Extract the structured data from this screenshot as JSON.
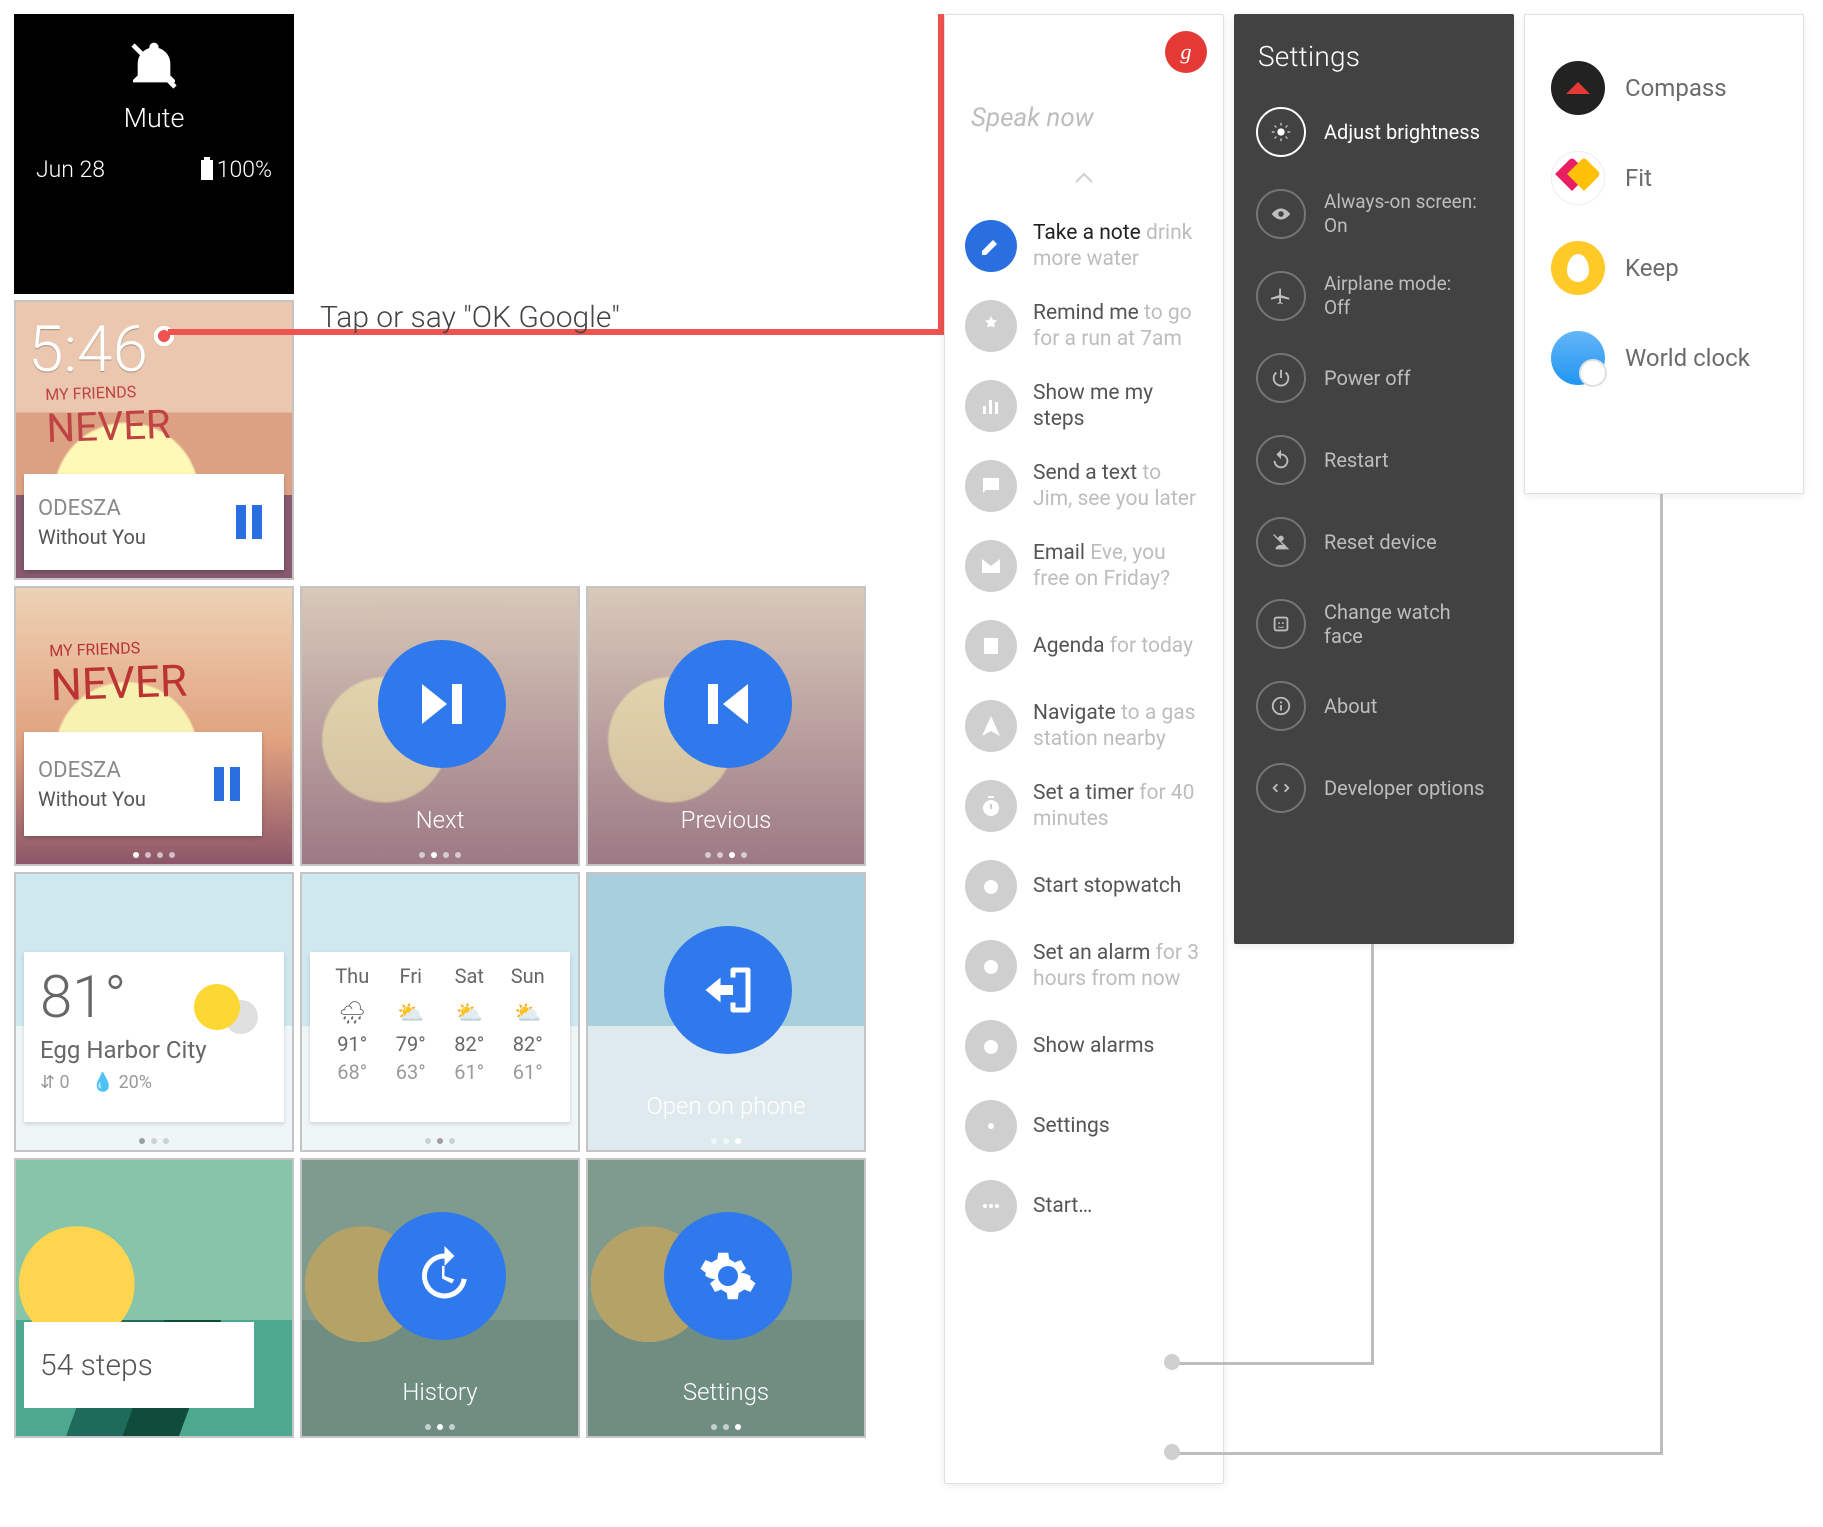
{
  "mute": {
    "label": "Mute",
    "date": "Jun 28",
    "battery": "100%"
  },
  "clock": {
    "time": "5:46",
    "artist": "ODESZA",
    "track": "Without You",
    "friends_top": "MY FRIENDS",
    "friends_big": "NEVER"
  },
  "annotation": "Tap or say \"OK Google\"",
  "nowplaying": {
    "artist": "ODESZA",
    "track": "Without You",
    "friends_top": "MY FRIENDS",
    "friends_big": "NEVER"
  },
  "controls": {
    "next": "Next",
    "previous": "Previous",
    "open": "Open on phone",
    "history": "History",
    "settings": "Settings"
  },
  "weather": {
    "temp": "81°",
    "city": "Egg Harbor City",
    "wind": "0",
    "humidity": "20%",
    "days": [
      "Thu",
      "Fri",
      "Sat",
      "Sun"
    ],
    "icons": [
      "🌧",
      "⛅",
      "⛅",
      "⛅"
    ],
    "hi": [
      "91°",
      "79°",
      "82°",
      "82°"
    ],
    "lo": [
      "68°",
      "63°",
      "61°",
      "61°"
    ]
  },
  "steps": {
    "text": "54 steps"
  },
  "voice": {
    "speak": "Speak now",
    "badge": "g",
    "items": [
      {
        "cmd": "Take a note",
        "ex": "drink more water",
        "icon": "pencil"
      },
      {
        "cmd": "Remind me",
        "ex": "to go for a run at 7am",
        "icon": "reminder"
      },
      {
        "cmd": "Show me my steps",
        "ex": "",
        "icon": "chart"
      },
      {
        "cmd": "Send a text",
        "ex": "to Jim, see you later",
        "icon": "sms"
      },
      {
        "cmd": "Email",
        "ex": "Eve, you free on Friday?",
        "icon": "mail"
      },
      {
        "cmd": "Agenda",
        "ex": "for today",
        "icon": "agenda"
      },
      {
        "cmd": "Navigate",
        "ex": "to a gas station nearby",
        "icon": "nav"
      },
      {
        "cmd": "Set a timer",
        "ex": "for 40 minutes",
        "icon": "timer"
      },
      {
        "cmd": "Start stopwatch",
        "ex": "",
        "icon": "stopwatch"
      },
      {
        "cmd": "Set an alarm",
        "ex": "for 3 hours from now",
        "icon": "alarm"
      },
      {
        "cmd": "Show alarms",
        "ex": "",
        "icon": "alarms"
      },
      {
        "cmd": "Settings",
        "ex": "",
        "icon": "gear"
      },
      {
        "cmd": "Start…",
        "ex": "",
        "icon": "more"
      }
    ]
  },
  "settings": {
    "title": "Settings",
    "items": [
      {
        "label": "Adjust brightness",
        "sub": "",
        "icon": "brightness"
      },
      {
        "label": "Always-on screen:",
        "sub": "On",
        "icon": "eye"
      },
      {
        "label": "Airplane mode:",
        "sub": "Off",
        "icon": "airplane"
      },
      {
        "label": "Power off",
        "sub": "",
        "icon": "power"
      },
      {
        "label": "Restart",
        "sub": "",
        "icon": "restart"
      },
      {
        "label": "Reset device",
        "sub": "",
        "icon": "reset"
      },
      {
        "label": "Change watch face",
        "sub": "",
        "icon": "face"
      },
      {
        "label": "About",
        "sub": "",
        "icon": "info"
      },
      {
        "label": "Developer options",
        "sub": "",
        "icon": "dev"
      }
    ]
  },
  "apps": {
    "items": [
      {
        "label": "Compass",
        "icon": "compass"
      },
      {
        "label": "Fit",
        "icon": "fit"
      },
      {
        "label": "Keep",
        "icon": "keep"
      },
      {
        "label": "World clock",
        "icon": "world"
      }
    ]
  }
}
